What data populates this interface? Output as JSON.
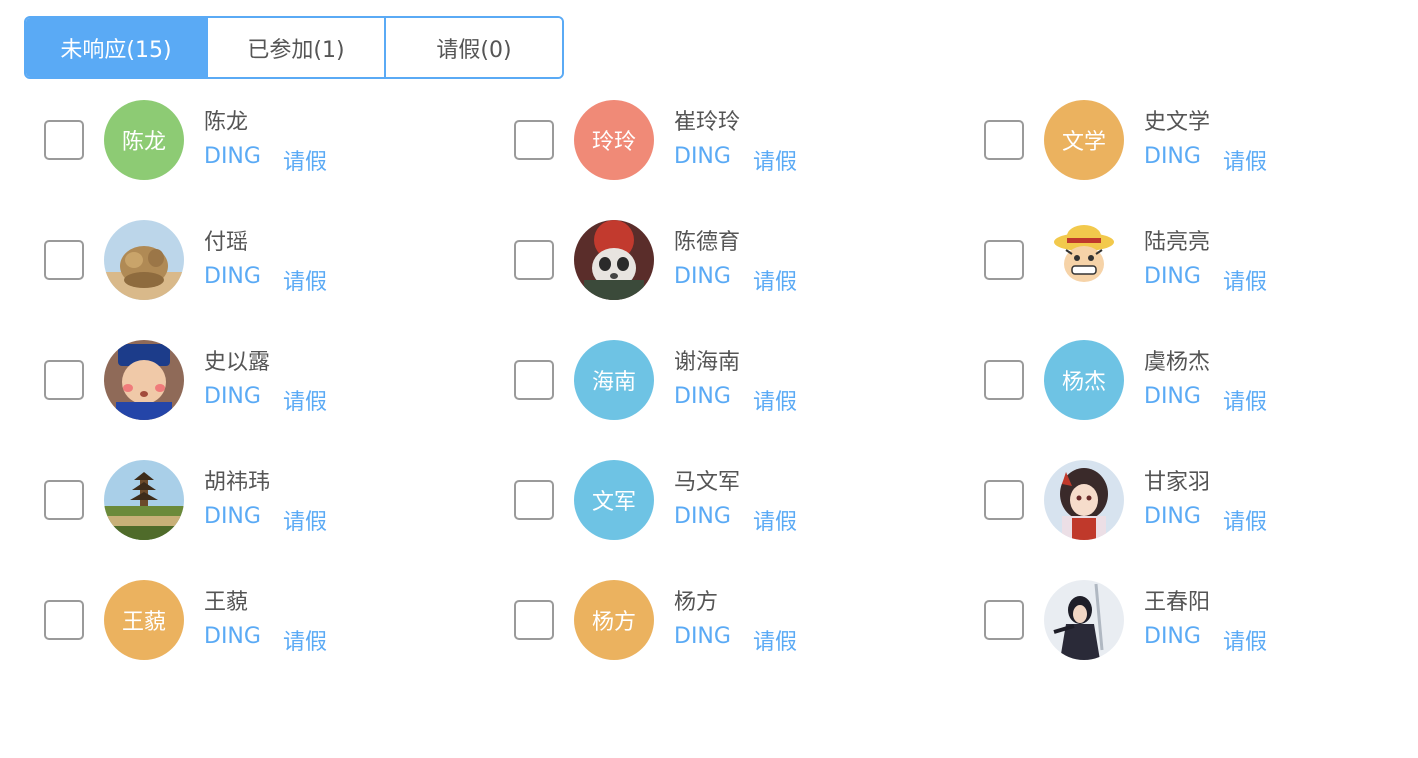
{
  "tabs": [
    {
      "label": "未响应(15)",
      "active": true
    },
    {
      "label": "已参加(1)",
      "active": false
    },
    {
      "label": "请假(0)",
      "active": false
    }
  ],
  "actions": {
    "ding": "DING",
    "leave": "请假"
  },
  "colors": {
    "accent": "#5aaaf5",
    "green": "#8dcb74",
    "salmon": "#f08a77",
    "orange": "#ebb25f",
    "sky": "#6ec3e4"
  },
  "members": [
    {
      "name": "陈龙",
      "avatar_type": "text",
      "avatar_text": "陈龙",
      "avatar_color": "#8dcb74"
    },
    {
      "name": "崔玲玲",
      "avatar_type": "text",
      "avatar_text": "玲玲",
      "avatar_color": "#f08a77"
    },
    {
      "name": "史文学",
      "avatar_type": "text",
      "avatar_text": "文学",
      "avatar_color": "#ebb25f"
    },
    {
      "name": "付瑶",
      "avatar_type": "image",
      "avatar_icon": "rock-creature-photo-icon"
    },
    {
      "name": "陈德育",
      "avatar_type": "image",
      "avatar_icon": "cartoon-panda-photo-icon"
    },
    {
      "name": "陆亮亮",
      "avatar_type": "image",
      "avatar_icon": "straw-hat-cartoon-photo-icon"
    },
    {
      "name": "史以露",
      "avatar_type": "image",
      "avatar_icon": "child-costume-photo-icon"
    },
    {
      "name": "谢海南",
      "avatar_type": "text",
      "avatar_text": "海南",
      "avatar_color": "#6ec3e4"
    },
    {
      "name": "虞杨杰",
      "avatar_type": "text",
      "avatar_text": "杨杰",
      "avatar_color": "#6ec3e4"
    },
    {
      "name": "胡祎玮",
      "avatar_type": "image",
      "avatar_icon": "pagoda-landscape-photo-icon"
    },
    {
      "name": "马文军",
      "avatar_type": "text",
      "avatar_text": "文军",
      "avatar_color": "#6ec3e4"
    },
    {
      "name": "甘家羽",
      "avatar_type": "image",
      "avatar_icon": "anime-girl-photo-icon"
    },
    {
      "name": "王藐",
      "avatar_type": "text",
      "avatar_text": "王藐",
      "avatar_color": "#ebb25f"
    },
    {
      "name": "杨方",
      "avatar_type": "text",
      "avatar_text": "杨方",
      "avatar_color": "#ebb25f"
    },
    {
      "name": "王春阳",
      "avatar_type": "image",
      "avatar_icon": "swordsman-photo-icon"
    }
  ]
}
